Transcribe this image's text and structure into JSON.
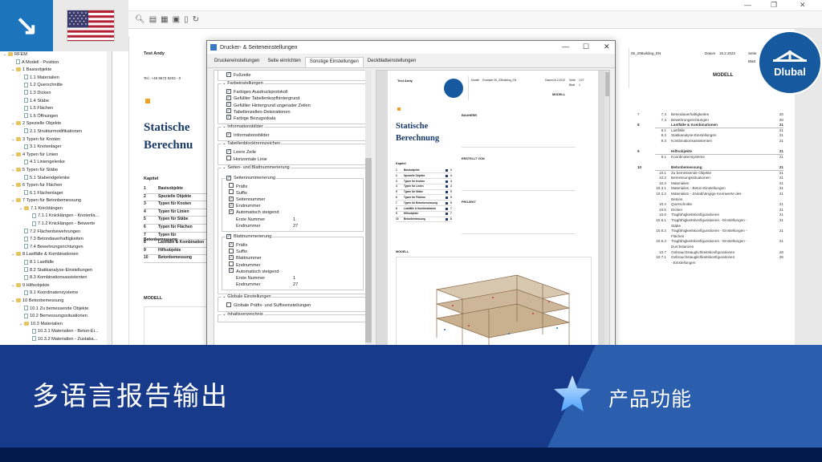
{
  "corner": {
    "arrow": "↘",
    "flag_name": "us-flag-icon"
  },
  "tree": {
    "items": [
      {
        "label": "RFEM",
        "lvl": 0,
        "type": "folder"
      },
      {
        "label": "A Modell - Position",
        "lvl": 1,
        "type": "doc"
      },
      {
        "label": "1 Basisobjekte",
        "lvl": 1,
        "type": "folder"
      },
      {
        "label": "1.1 Materialien",
        "lvl": 2,
        "type": "doc"
      },
      {
        "label": "1.2 Querschnitte",
        "lvl": 2,
        "type": "doc"
      },
      {
        "label": "1.3 Dicken",
        "lvl": 2,
        "type": "doc"
      },
      {
        "label": "1.4 Stäbe",
        "lvl": 2,
        "type": "doc"
      },
      {
        "label": "1.5 Flächen",
        "lvl": 2,
        "type": "doc"
      },
      {
        "label": "1.6 Öffnungen",
        "lvl": 2,
        "type": "doc"
      },
      {
        "label": "2 Spezielle Objekte",
        "lvl": 1,
        "type": "folder"
      },
      {
        "label": "2.1 Strukturmodifikationen",
        "lvl": 2,
        "type": "doc"
      },
      {
        "label": "3 Typen für Knoten",
        "lvl": 1,
        "type": "folder"
      },
      {
        "label": "3.1 Knotenlager",
        "lvl": 2,
        "type": "doc"
      },
      {
        "label": "4 Typen für Linien",
        "lvl": 1,
        "type": "folder"
      },
      {
        "label": "4.1 Liniengelenke",
        "lvl": 2,
        "type": "doc"
      },
      {
        "label": "5 Typen für Stäbe",
        "lvl": 1,
        "type": "folder"
      },
      {
        "label": "5.1 Stabendgelenke",
        "lvl": 2,
        "type": "doc"
      },
      {
        "label": "6 Typen für Flächen",
        "lvl": 1,
        "type": "folder"
      },
      {
        "label": "6.1 Flächenlager",
        "lvl": 2,
        "type": "doc"
      },
      {
        "label": "7 Typen für Betonbemessung",
        "lvl": 1,
        "type": "folder"
      },
      {
        "label": "7.1 Knicklängen",
        "lvl": 2,
        "type": "folder"
      },
      {
        "label": "7.1.1 Knicklängen - Knotenla...",
        "lvl": 3,
        "type": "doc"
      },
      {
        "label": "7.1.2 Knicklängen - Beiwerte",
        "lvl": 3,
        "type": "doc"
      },
      {
        "label": "7.2 Flächenbewehrungen",
        "lvl": 2,
        "type": "doc"
      },
      {
        "label": "7.3 Betondauerhaftigkeiten",
        "lvl": 2,
        "type": "doc"
      },
      {
        "label": "7.4 Bewehrungsrichtungen",
        "lvl": 2,
        "type": "doc"
      },
      {
        "label": "8 Lastfälle & Kombinationen",
        "lvl": 1,
        "type": "folder"
      },
      {
        "label": "8.1 Lastfälle",
        "lvl": 2,
        "type": "doc"
      },
      {
        "label": "8.2 Statikanalyse-Einstellungen",
        "lvl": 2,
        "type": "doc"
      },
      {
        "label": "8.3 Kombinationsassistenten",
        "lvl": 2,
        "type": "doc"
      },
      {
        "label": "9 Hilfsobjekte",
        "lvl": 1,
        "type": "folder"
      },
      {
        "label": "9.1 Koordinatensysteme",
        "lvl": 2,
        "type": "doc"
      },
      {
        "label": "10 Betonbemessung",
        "lvl": 1,
        "type": "folder"
      },
      {
        "label": "10.1 Zu bemessende Objekte",
        "lvl": 2,
        "type": "doc"
      },
      {
        "label": "10.2 Bemessungssituationen",
        "lvl": 2,
        "type": "doc"
      },
      {
        "label": "10.3 Materialien",
        "lvl": 2,
        "type": "folder"
      },
      {
        "label": "10.3.1 Materialien - Beton-Ei...",
        "lvl": 3,
        "type": "doc"
      },
      {
        "label": "10.3.2 Materialien - Zustaba...",
        "lvl": 3,
        "type": "doc"
      }
    ]
  },
  "report": {
    "author": "Test Andy",
    "phone": "Tel.: +49 9673 9203 - 0",
    "title_line1": "Statische",
    "title_line2": "Berechnu",
    "chapter_heading": "Kapitel",
    "chapters": [
      {
        "n": "1",
        "t": "Basisobjekte"
      },
      {
        "n": "2",
        "t": "Spezielle Objekte"
      },
      {
        "n": "3",
        "t": "Typen für Knoten"
      },
      {
        "n": "4",
        "t": "Typen für Linien"
      },
      {
        "n": "5",
        "t": "Typen für Stäbe"
      },
      {
        "n": "6",
        "t": "Typen für Flächen"
      },
      {
        "n": "7",
        "t": "Typen für Betonbemessung"
      },
      {
        "n": "8",
        "t": "Lastfälle & Kombination"
      },
      {
        "n": "9",
        "t": "Hilfsobjekte"
      },
      {
        "n": "10",
        "t": "Betonbemessung"
      }
    ],
    "model_label": "MODELL",
    "top_right_partial": "05_20Building_EN",
    "datum_label": "Datum",
    "datum_value": "16.2.2022",
    "seite_label": "Seite",
    "blatt_label": "Blatt",
    "modell_heading": "MODELL",
    "toc_right": [
      {
        "c": "7",
        "t": "7.3",
        "x": "Betondauerhaftigkeiten",
        "p": "20",
        "b": false
      },
      {
        "c": "",
        "t": "7.4",
        "x": "Bewehrungsrichtungen",
        "p": "20",
        "b": false
      },
      {
        "c": "8",
        "t": "",
        "x": "Lastfälle & Kombinationen",
        "p": "21",
        "b": true
      },
      {
        "c": "",
        "t": "8.1",
        "x": "Lastfälle",
        "p": "21",
        "b": false
      },
      {
        "c": "",
        "t": "8.2",
        "x": "Statikanalyse-Einstellungen",
        "p": "21",
        "b": false
      },
      {
        "c": "",
        "t": "8.3",
        "x": "Kombinationsassistenten",
        "p": "21",
        "b": false
      },
      {
        "c": "",
        "t": "",
        "x": "",
        "p": "",
        "b": false
      },
      {
        "c": "9",
        "t": "",
        "x": "Hilfsobjekte",
        "p": "21",
        "b": true
      },
      {
        "c": "",
        "t": "9.1",
        "x": "Koordinatensysteme",
        "p": "21",
        "b": false
      },
      {
        "c": "",
        "t": "",
        "x": "",
        "p": "",
        "b": false
      },
      {
        "c": "10",
        "t": "",
        "x": "Betonbemessung",
        "p": "21",
        "b": true
      },
      {
        "c": "",
        "t": "10.1",
        "x": "Zu bemessende Objekte",
        "p": "21",
        "b": false
      },
      {
        "c": "",
        "t": "10.2",
        "x": "Bemessungssituationen",
        "p": "21",
        "b": false
      },
      {
        "c": "",
        "t": "10.3",
        "x": "Materialien",
        "p": "21",
        "b": false
      },
      {
        "c": "",
        "t": "10.3.1",
        "x": "Materialien - Beton-Einstellungen",
        "p": "21",
        "b": false
      },
      {
        "c": "",
        "t": "10.3.2",
        "x": "Materialien - Zeitabhängige Kennwerte des",
        "p": "21",
        "b": false
      },
      {
        "c": "",
        "t": "",
        "x": "Betons",
        "p": "",
        "b": false
      },
      {
        "c": "",
        "t": "10.4",
        "x": "Querschnitte",
        "p": "21",
        "b": false
      },
      {
        "c": "",
        "t": "10.5",
        "x": "Dicken",
        "p": "21",
        "b": false
      },
      {
        "c": "",
        "t": "10.6",
        "x": "Tragfähigkeitskonfigurationen",
        "p": "21",
        "b": false
      },
      {
        "c": "",
        "t": "10.6.1",
        "x": "Tragfähigkeitskonfigurationen - Einstellungen -",
        "p": "21",
        "b": false
      },
      {
        "c": "",
        "t": "",
        "x": "Stäbe",
        "p": "",
        "b": false
      },
      {
        "c": "",
        "t": "10.6.2",
        "x": "Tragfähigkeitskonfigurationen - Einstellungen -",
        "p": "21",
        "b": false
      },
      {
        "c": "",
        "t": "",
        "x": "Flächen",
        "p": "",
        "b": false
      },
      {
        "c": "",
        "t": "10.6.3",
        "x": "Tragfähigkeitskonfigurationen - Einstellungen -",
        "p": "21",
        "b": false
      },
      {
        "c": "",
        "t": "",
        "x": "Durchstanzen",
        "p": "",
        "b": false
      },
      {
        "c": "",
        "t": "10.7",
        "x": "Gebrauchstauglichkeitskonfigurationen",
        "p": "26",
        "b": false
      },
      {
        "c": "",
        "t": "10.7.1",
        "x": "Gebrauchstauglichkeitskonfigurationen",
        "p": "26",
        "b": false
      },
      {
        "c": "",
        "t": "",
        "x": "- Einstellungen",
        "p": "",
        "b": false
      }
    ]
  },
  "logo": {
    "text": "Dlubal"
  },
  "dialog": {
    "title": "Drucker- & Seiteneinstellungen",
    "tabs": [
      "Druckereinstellungen",
      "Seite einrichten",
      "Sonstige Einstellungen",
      "Deckblatteinstellungen"
    ],
    "active_tab": 2,
    "groups": {
      "fusszeile": {
        "label": "Fußzeile",
        "items": [
          {
            "t": "Fußzeile",
            "c": true
          }
        ]
      },
      "farben": {
        "label": "Farbeinstellungen",
        "items": [
          {
            "t": "Farbiges Ausdruckprotokoll",
            "c": true
          },
          {
            "t": "Gefüllter Tabellenkopfhintergrund",
            "c": true
          },
          {
            "t": "Gefüllter Hintergrund ungerader Zeilen",
            "c": true
          },
          {
            "t": "Tabellenzellen-Dekorationen",
            "c": true
          },
          {
            "t": "Farbige Bezugsskala",
            "c": true
          }
        ]
      },
      "info": {
        "label": "Informationsbilder",
        "items": [
          {
            "t": "Informationsbilder",
            "c": true
          }
        ]
      },
      "trenn": {
        "label": "Tabellenblocktrennzeichen",
        "items": [
          {
            "t": "Leere Zeile",
            "c": true
          },
          {
            "t": "Horizontale Linie",
            "c": false
          }
        ]
      },
      "seiten": {
        "label": "Seiten- und Blattnummerierung",
        "seitennum": {
          "label": "Seitennummerierung",
          "items": [
            {
              "t": "Präfix",
              "c": false
            },
            {
              "t": "Suffix",
              "c": false
            },
            {
              "t": "Seitennummer",
              "c": true
            },
            {
              "t": "Endnummer",
              "c": true
            },
            {
              "t": "Automatisch steigend",
              "c": true
            }
          ],
          "erste_label": "Erste Nummer",
          "erste_value": "1",
          "end_label": "Endnummer",
          "end_value": "27"
        },
        "blattnum": {
          "label": "Blattnummerierung",
          "items": [
            {
              "t": "Präfix",
              "c": true
            },
            {
              "t": "Suffix",
              "c": false
            },
            {
              "t": "Blattnummer",
              "c": true
            },
            {
              "t": "Endnummer",
              "c": false
            },
            {
              "t": "Automatisch steigend",
              "c": true
            }
          ],
          "erste_label": "Erste Nummer",
          "erste_value": "1",
          "end_label": "Endnummer",
          "end_value": "27"
        }
      },
      "global": {
        "label": "Globale Einstellungen",
        "items": [
          {
            "t": "Globale Präfix- und Suffixeinstellungen",
            "c": false
          }
        ]
      },
      "inhalt": {
        "label": "Inhaltsverzeichnis"
      }
    }
  },
  "preview": {
    "author": "Test Andy",
    "modell_label": "Modell",
    "modell_value": "Example 05_20Building_EN",
    "datum_label": "Datum",
    "datum_value": "16.2.2022",
    "seite_label": "Seite",
    "seite_value": "1/27",
    "blatt_label": "Blatt",
    "blatt_value": "1",
    "modell_heading": "MODELL",
    "title_line1": "Statische",
    "title_line2": "Berechnung",
    "bauherr": "BAUHERR",
    "erstellt": "ERSTELLT VON",
    "projekt": "PROJEKT",
    "kapitel": "Kapitel",
    "modell2": "MODELL",
    "chapters": [
      {
        "n": "1",
        "t": "Basisobjekte",
        "p": "3"
      },
      {
        "n": "2",
        "t": "Spezielle Objekte",
        "p": "4"
      },
      {
        "n": "3",
        "t": "Typen für Knoten",
        "p": "4"
      },
      {
        "n": "4",
        "t": "Typen für Linien",
        "p": "4"
      },
      {
        "n": "5",
        "t": "Typen für Stäbe",
        "p": "5"
      },
      {
        "n": "6",
        "t": "Typen für Flächen",
        "p": "5"
      },
      {
        "n": "7",
        "t": "Typen für Betonbemessung",
        "p": "5"
      },
      {
        "n": "8",
        "t": "Lastfälle & Kombinationen",
        "p": "7"
      },
      {
        "n": "9",
        "t": "Hilfsobjekte",
        "p": "7"
      },
      {
        "n": "10",
        "t": "Betonbemessung",
        "p": "8"
      }
    ]
  },
  "banner": {
    "headline": "多语言报告输出",
    "feature": "产品功能"
  },
  "colors": {
    "banner": "#173a8a",
    "accent": "#2b5fad",
    "dark": "#001a4c",
    "brand": "#1c75bc"
  }
}
